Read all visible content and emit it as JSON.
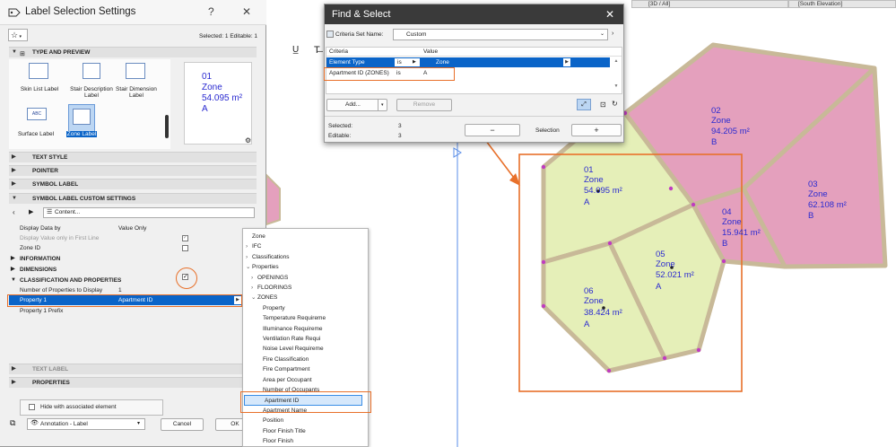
{
  "canvas": {
    "tabs": [
      "[3D / All]",
      "[South Elevation]"
    ],
    "zones": [
      {
        "number": "01",
        "name": "Zone",
        "area": "54.095 m²",
        "id": "A"
      },
      {
        "number": "02",
        "name": "Zone",
        "area": "94.205 m²",
        "id": "B"
      },
      {
        "number": "03",
        "name": "Zone",
        "area": "62.108 m²",
        "id": "B"
      },
      {
        "number": "04",
        "name": "Zone",
        "area": "15.941 m²",
        "id": "B"
      },
      {
        "number": "05",
        "name": "Zone",
        "area": "52.021 m²",
        "id": "A"
      },
      {
        "number": "06",
        "name": "Zone",
        "area": "38.424 m²",
        "id": "A"
      }
    ],
    "colors": {
      "zone_a": "#e5efb8",
      "zone_b": "#e4a0bd",
      "wall": "#c8b998",
      "highlight": "#e8702a",
      "label": "#2a2ad0",
      "select_blue": "#0a64c8"
    }
  },
  "lss": {
    "title": "Label Selection Settings",
    "help": "?",
    "close": "✕",
    "selected_info": "Selected: 1 Editable: 1",
    "sections": {
      "type_preview": "TYPE AND PREVIEW",
      "text_style": "TEXT STYLE",
      "pointer": "POINTER",
      "symbol_label": "SYMBOL LABEL",
      "custom_settings": "SYMBOL LABEL CUSTOM SETTINGS",
      "text_label": "TEXT LABEL",
      "properties": "PROPERTIES"
    },
    "label_types": [
      "Skin List Label",
      "Stair Description Label",
      "Stair Dimension Label",
      "Surface Label",
      "Zone Label"
    ],
    "preview": {
      "number": "01",
      "name": "Zone",
      "area": "54.095 m²",
      "id": "A"
    },
    "content_label": "Content...",
    "rows": {
      "display_data_by": "Display Data by",
      "display_data_by_value": "Value Only",
      "display_first_line": "Display Value only in First Line",
      "zone_id": "Zone ID",
      "information": "INFORMATION",
      "dimensions": "DIMENSIONS",
      "classification": "CLASSIFICATION AND PROPERTIES",
      "num_properties": "Number of Properties to Display",
      "num_properties_value": "1",
      "property1": "Property 1",
      "property1_value": "Apartment ID",
      "property1_prefix": "Property 1 Prefix"
    },
    "hide_associated": "Hide with associated element",
    "layer": "Annotation - Label",
    "cancel": "Cancel",
    "ok": "OK"
  },
  "fs": {
    "title": "Find & Select",
    "criteria_set_label": "Criteria Set Name:",
    "criteria_set_value": "Custom",
    "col_criteria": "Criteria",
    "col_value": "Value",
    "rows": [
      {
        "criteria": "Element Type",
        "op": "is",
        "value": "Zone"
      },
      {
        "criteria": "Apartment ID (ZONES)",
        "op": "is",
        "value": "A"
      }
    ],
    "add": "Add...",
    "remove": "Remove",
    "selected_label": "Selected:",
    "selected_value": "3",
    "editable_label": "Editable:",
    "editable_value": "3",
    "minus": "−",
    "selection": "Selection",
    "plus": "+"
  },
  "menu": {
    "items": [
      {
        "label": "Zone",
        "indent": 0,
        "arrow": ""
      },
      {
        "label": "IFC",
        "indent": 0,
        "arrow": "›"
      },
      {
        "label": "Classifications",
        "indent": 0,
        "arrow": "›"
      },
      {
        "label": "Properties",
        "indent": 0,
        "arrow": "⌄"
      },
      {
        "label": "OPENINGS",
        "indent": 1,
        "arrow": "›"
      },
      {
        "label": "FLOORINGS",
        "indent": 1,
        "arrow": "›"
      },
      {
        "label": "ZONES",
        "indent": 1,
        "arrow": "⌄"
      },
      {
        "label": "Property",
        "indent": 2,
        "arrow": ""
      },
      {
        "label": "Temperature Requireme",
        "indent": 2,
        "arrow": ""
      },
      {
        "label": "Illuminance Requireme",
        "indent": 2,
        "arrow": ""
      },
      {
        "label": "Ventilation Rate Requi",
        "indent": 2,
        "arrow": ""
      },
      {
        "label": "Noise Level Requireme",
        "indent": 2,
        "arrow": ""
      },
      {
        "label": "Fire Classification",
        "indent": 2,
        "arrow": ""
      },
      {
        "label": "Fire Compartment",
        "indent": 2,
        "arrow": ""
      },
      {
        "label": "Area per Occupant",
        "indent": 2,
        "arrow": ""
      },
      {
        "label": "Number of Occupants",
        "indent": 2,
        "arrow": ""
      },
      {
        "label": "Apartment ID",
        "indent": 2,
        "arrow": "",
        "selected": true
      },
      {
        "label": "Apartment Name",
        "indent": 2,
        "arrow": ""
      },
      {
        "label": "Position",
        "indent": 2,
        "arrow": ""
      },
      {
        "label": "Floor Finish Title",
        "indent": 2,
        "arrow": ""
      },
      {
        "label": "Floor Finish",
        "indent": 2,
        "arrow": ""
      }
    ]
  }
}
